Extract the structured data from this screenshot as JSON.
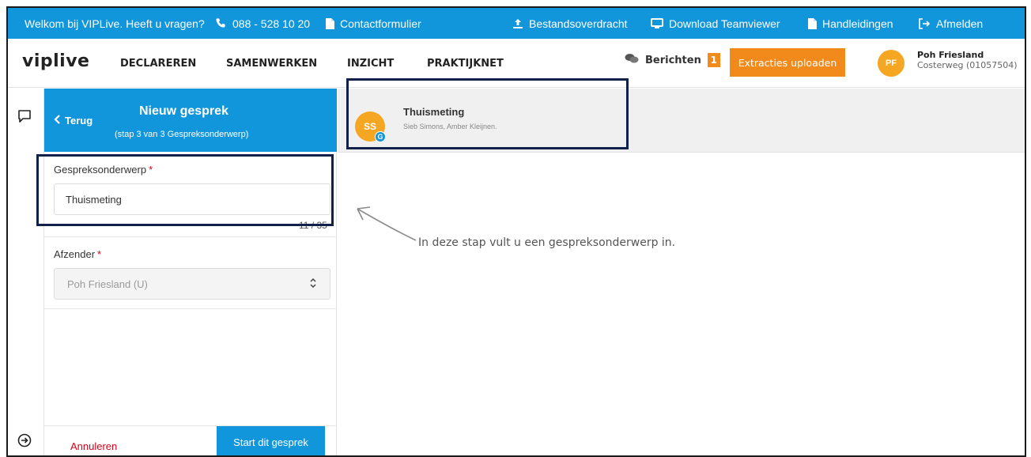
{
  "topbar": {
    "welcome": "Welkom bij VIPLive. Heeft u vragen?",
    "phone": "088 - 528 10 20",
    "contact": "Contactformulier",
    "transfer": "Bestandsoverdracht",
    "teamviewer": "Download Teamviewer",
    "manuals": "Handleidingen",
    "logout": "Afmelden"
  },
  "nav": {
    "logo": "viplive",
    "items": [
      "DECLAREREN",
      "SAMENWERKEN",
      "INZICHT",
      "PRAKTIJKNET"
    ],
    "messages_label": "Berichten",
    "messages_count": "1",
    "upload_button": "Extracties uploaden",
    "user_initials": "PF",
    "user_name": "Poh Friesland",
    "user_location": "Costerweg (01057504)"
  },
  "panel": {
    "back_label": "Terug",
    "title": "Nieuw gesprek",
    "step": "(stap 3 van 3 Gespreksonderwerp)",
    "subject_label": "Gespreksonderwerp",
    "required_mark": "*",
    "subject_value": "Thuismeting",
    "char_counter": "11 / 35",
    "sender_label": "Afzender",
    "sender_value": "Poh Friesland (U)",
    "cancel_label": "Annuleren",
    "start_button": "Start dit gesprek"
  },
  "conversation": {
    "avatar_initials": "SS",
    "group_badge": "G",
    "title": "Thuismeting",
    "participants": "Sieb Simons, Amber Kleijnen."
  },
  "hint_text": "In deze stap vult u een gespreksonderwerp in.",
  "colors": {
    "primary_blue": "#1296db",
    "accent_orange": "#f28a1b",
    "avatar_orange": "#f5a623",
    "required_red": "#d0021b",
    "highlight_navy": "#12214a"
  }
}
